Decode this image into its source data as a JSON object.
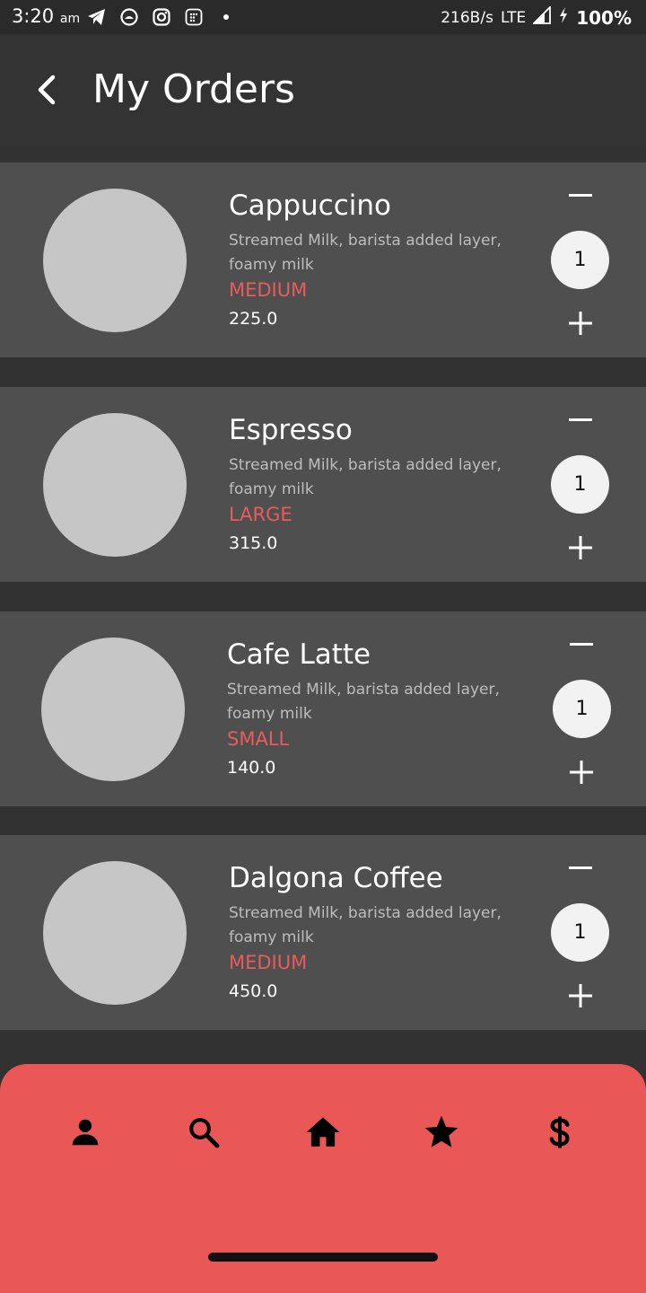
{
  "status_bar": {
    "time": "3:20",
    "ampm": "am",
    "net_speed": "216B/s",
    "network": "LTE",
    "battery": "100%",
    "icons": [
      "telegram-icon",
      "chat-icon",
      "instagram-icon",
      "app-icon",
      "dot-icon"
    ]
  },
  "header": {
    "back_icon": "chevron-left-icon",
    "title": "My Orders"
  },
  "orders": [
    {
      "name": "Cappuccino",
      "description": "Streamed Milk, barista added layer, foamy milk",
      "size": "MEDIUM",
      "price": "225.0",
      "quantity": "1"
    },
    {
      "name": "Espresso",
      "description": "Streamed Milk, barista added layer, foamy milk",
      "size": "LARGE",
      "price": "315.0",
      "quantity": "1"
    },
    {
      "name": "Cafe Latte",
      "description": "Streamed Milk, barista  added layer, foamy milk",
      "size": "SMALL",
      "price": "140.0",
      "quantity": "1"
    },
    {
      "name": "Dalgona Coffee",
      "description": "Streamed Milk, barista added layer, foamy milk",
      "size": "MEDIUM",
      "price": "450.0",
      "quantity": "1"
    }
  ],
  "bottom_nav": {
    "items": [
      "person-icon",
      "search-icon",
      "home-icon",
      "star-icon",
      "dollar-icon"
    ]
  },
  "colors": {
    "background": "#323232",
    "card": "#4f4f4f",
    "accent": "#e95757",
    "size_text": "#e85c5c",
    "thumbnail": "#c6c6c6"
  }
}
